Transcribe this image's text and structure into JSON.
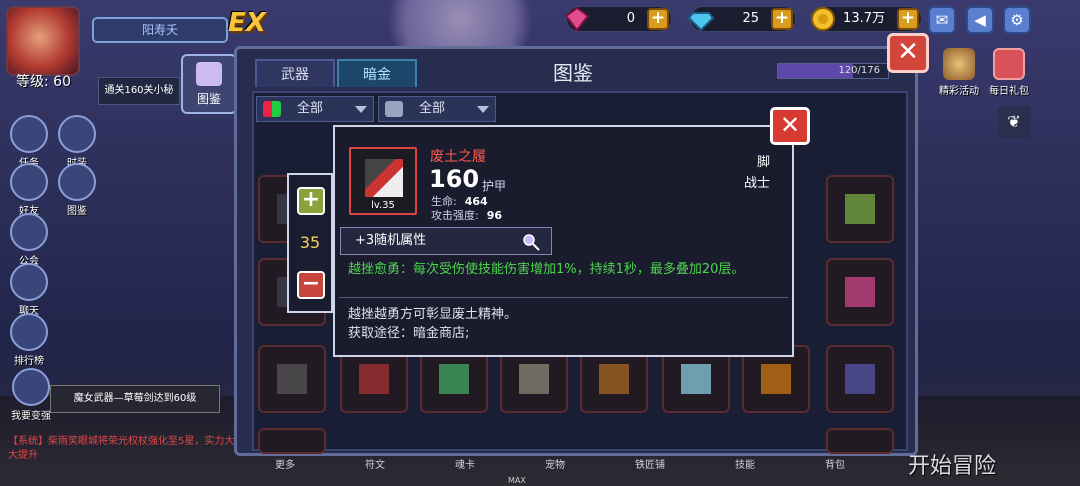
{
  "player": {
    "name": "阳寿夭",
    "level_text": "等级: 60",
    "ex_badge": "EX"
  },
  "currencies": [
    {
      "icon": "gem-icon",
      "value": "0",
      "color": "#e04c8c"
    },
    {
      "icon": "diamond-icon",
      "value": "25",
      "color": "#4fc6ee"
    },
    {
      "icon": "coin-icon",
      "value": "13.7万",
      "color": "#f2c02a"
    }
  ],
  "system_icons": [
    "mail-icon",
    "speaker-icon",
    "gear-icon"
  ],
  "right_menu": [
    {
      "icon": "event-icon",
      "label": "精彩活动"
    },
    {
      "icon": "gift-icon",
      "label": "每日礼包"
    }
  ],
  "left_menu": [
    {
      "icon": "quest-icon",
      "label": "任务"
    },
    {
      "icon": "costume-icon",
      "label": "时装"
    },
    {
      "icon": "friends-icon",
      "label": "好友"
    },
    {
      "icon": "codex-icon",
      "label": "图鉴"
    },
    {
      "icon": "guild-icon",
      "label": "公会"
    },
    {
      "icon": "chat-icon",
      "label": "聊天"
    },
    {
      "icon": "ranking-icon",
      "label": "排行榜"
    },
    {
      "icon": "strengthen-icon",
      "label": "我要变强"
    }
  ],
  "quest_text": "通关160关小秘",
  "codex_button": "图鉴",
  "panel": {
    "tabs": [
      "武器",
      "暗金"
    ],
    "active_tab": "暗金",
    "title": "图鉴",
    "progress_text": "120/176",
    "progress": 0.68,
    "filters": [
      {
        "label": "全部",
        "icon": "grid-icon"
      },
      {
        "label": "全部",
        "icon": "class-icon"
      }
    ]
  },
  "detail": {
    "item_name": "废土之履",
    "item_level": "lv.35",
    "power": "160",
    "power_unit": "护甲",
    "stats": [
      {
        "label": "生命:",
        "value": "464"
      },
      {
        "label": "攻击强度:",
        "value": "96"
      }
    ],
    "slot": "脚",
    "class": "战士",
    "random_attr": "+3随机属性",
    "skill": "越挫愈勇：每次受伤使技能伤害增加1%，持续1秒，最多叠加20层。",
    "flavor": "越挫越勇方可彰显废土精神。",
    "source": "获取途径：暗金商店;",
    "stepper_value": "35"
  },
  "toast": "魔女武器—草莓剑达到60级",
  "chat": "【系统】柴雨笑眼城将荣光权杖强化至5星，实力大大提升",
  "start_button": "开始冒险",
  "bottom_tabs": [
    "更多",
    "符文",
    "魂卡",
    "宠物",
    "铁匠铺",
    "技能",
    "背包"
  ],
  "max_label": "MAX"
}
